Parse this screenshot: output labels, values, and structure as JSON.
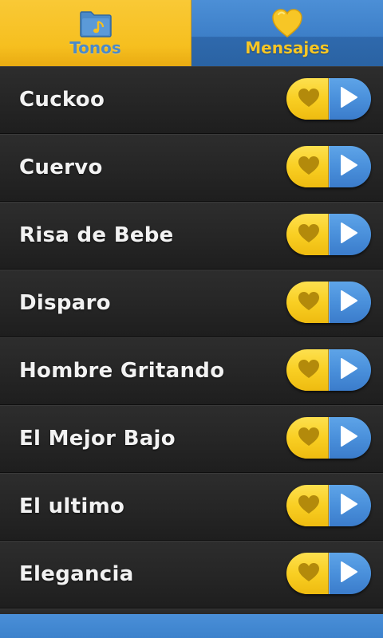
{
  "tabs": [
    {
      "label": "Tonos",
      "icon": "folder-music-icon",
      "active": true
    },
    {
      "label": "Mensajes",
      "icon": "heart-icon",
      "active": false
    }
  ],
  "ringtones": [
    {
      "title": "Cuckoo"
    },
    {
      "title": "Cuervo"
    },
    {
      "title": "Risa de Bebe"
    },
    {
      "title": "Disparo"
    },
    {
      "title": "Hombre Gritando"
    },
    {
      "title": "El Mejor Bajo"
    },
    {
      "title": "El ultimo"
    },
    {
      "title": "Elegancia"
    }
  ],
  "row_actions": {
    "favorite_icon": "heart-icon",
    "play_icon": "play-icon"
  },
  "colors": {
    "yellow": "#f6bf1f",
    "blue": "#4a90db",
    "row_background": "#262626",
    "title_text": "#f2f2f2"
  }
}
